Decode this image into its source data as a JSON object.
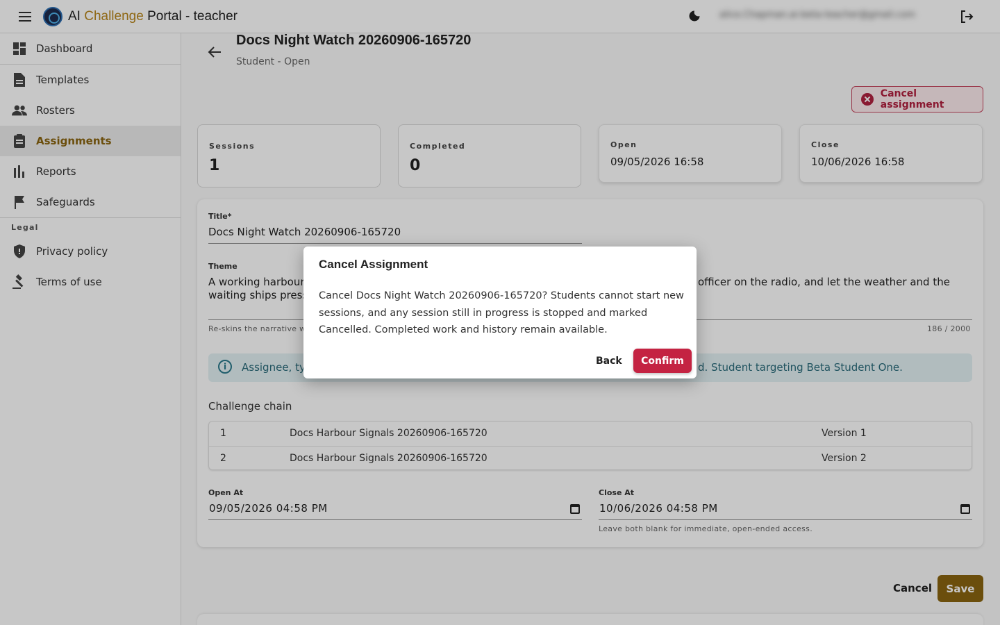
{
  "app": {
    "title_prefix": "AI ",
    "title_accent": "Challenge",
    "title_suffix": " Portal - teacher",
    "user_email": "alice.Chapman.ai-beta-teacher@gmail.com"
  },
  "sidebar": {
    "items": [
      {
        "label": "Dashboard",
        "icon": "dashboard-icon"
      },
      {
        "label": "Templates",
        "icon": "document-icon"
      },
      {
        "label": "Rosters",
        "icon": "people-icon"
      },
      {
        "label": "Assignments",
        "icon": "clipboard-icon",
        "active": true
      },
      {
        "label": "Reports",
        "icon": "bar-chart-icon"
      },
      {
        "label": "Safeguards",
        "icon": "flag-icon"
      }
    ],
    "legal_heading": "Legal",
    "legal_items": [
      {
        "label": "Privacy policy",
        "icon": "shield-icon"
      },
      {
        "label": "Terms of use",
        "icon": "gavel-icon"
      }
    ]
  },
  "page": {
    "title": "Docs Night Watch 20260906-165720",
    "subtitle": "Student - Open",
    "cancel_assignment_label": "Cancel assignment"
  },
  "stats": {
    "sessions": {
      "label": "Sessions",
      "value": "1"
    },
    "completed": {
      "label": "Completed",
      "value": "0"
    },
    "open": {
      "label": "Open",
      "value": "09/05/2026 16:58"
    },
    "close": {
      "label": "Close",
      "value": "10/06/2026 16:58"
    }
  },
  "form": {
    "title_label": "Title*",
    "title_value": "Docs Night Watch 20260906-165720",
    "theme_label": "Theme",
    "theme_line1_left": "A working harbour",
    "theme_line1_right": "officer on the radio, and let the weather and the",
    "theme_line2_left": "waiting ships press",
    "theme_helper": "Re-skins the narrative w",
    "theme_counter": "186 / 2000",
    "info_left": "Assignee, ty",
    "info_right": "d. Student targeting Beta Student One.",
    "chain_label": "Challenge chain",
    "chain": [
      {
        "index": "1",
        "name": "Docs Harbour Signals 20260906-165720",
        "version": "Version 1"
      },
      {
        "index": "2",
        "name": "Docs Harbour Signals 20260906-165720",
        "version": "Version 2"
      }
    ],
    "open_at_label": "Open At",
    "open_at_value": "09/05/2026 04:58 PM",
    "close_at_label": "Close At",
    "close_at_value": "10/06/2026 04:58 PM",
    "dates_helper": "Leave both blank for immediate, open-ended access."
  },
  "footer": {
    "cancel_label": "Cancel",
    "save_label": "Save"
  },
  "dialog": {
    "title": "Cancel Assignment",
    "body": "Cancel Docs Night Watch 20260906-165720? Students cannot start new sessions, and any session still in progress is stopped and marked Cancelled. Completed work and history remain available.",
    "back_label": "Back",
    "confirm_label": "Confirm"
  },
  "colors": {
    "accent": "#8a6410",
    "danger": "#c42342",
    "info": "#2b6c7c"
  }
}
